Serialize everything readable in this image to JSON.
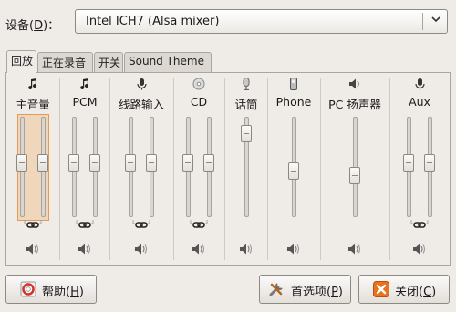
{
  "device": {
    "label": "设备(D)：",
    "label_prefix": "设备(",
    "label_mnemonic": "D",
    "label_suffix": ")：",
    "value": "Intel ICH7 (Alsa mixer)"
  },
  "tabs": [
    "回放",
    "正在录音",
    "开关",
    "Sound Theme"
  ],
  "channels": [
    {
      "label": "主音量",
      "icon": "music-note-icon",
      "levels": [
        0.55,
        0.55
      ],
      "selected": true
    },
    {
      "label": "PCM",
      "icon": "music-note-icon",
      "levels": [
        0.55,
        0.55
      ]
    },
    {
      "label": "线路输入",
      "icon": "microphone-icon",
      "levels": [
        0.55,
        0.55
      ]
    },
    {
      "label": "CD",
      "icon": "cd-icon",
      "levels": [
        0.55,
        0.55
      ]
    },
    {
      "label": "话筒",
      "icon": "microphone-stand-icon",
      "levels": [
        0.9
      ]
    },
    {
      "label": "Phone",
      "icon": "phone-icon",
      "levels": [
        0.45
      ]
    },
    {
      "label": "PC 扬声器",
      "icon": "speaker-icon",
      "levels": [
        0.4
      ]
    },
    {
      "label": "Aux",
      "icon": "microphone-icon",
      "levels": [
        0.55,
        0.55
      ]
    }
  ],
  "buttons": {
    "help": {
      "prefix": "帮助(",
      "mnemonic": "H",
      "suffix": ")",
      "icon": "help-lifebuoy-icon"
    },
    "preferences": {
      "prefix": "首选项(",
      "mnemonic": "P",
      "suffix": ")",
      "icon": "tools-icon"
    },
    "close": {
      "prefix": "关闭(",
      "mnemonic": "C",
      "suffix": ")",
      "icon": "close-icon"
    }
  },
  "colors": {
    "selection": "#f0d7bb",
    "selection_border": "#e39a5a",
    "close_icon": "#e8731f"
  }
}
